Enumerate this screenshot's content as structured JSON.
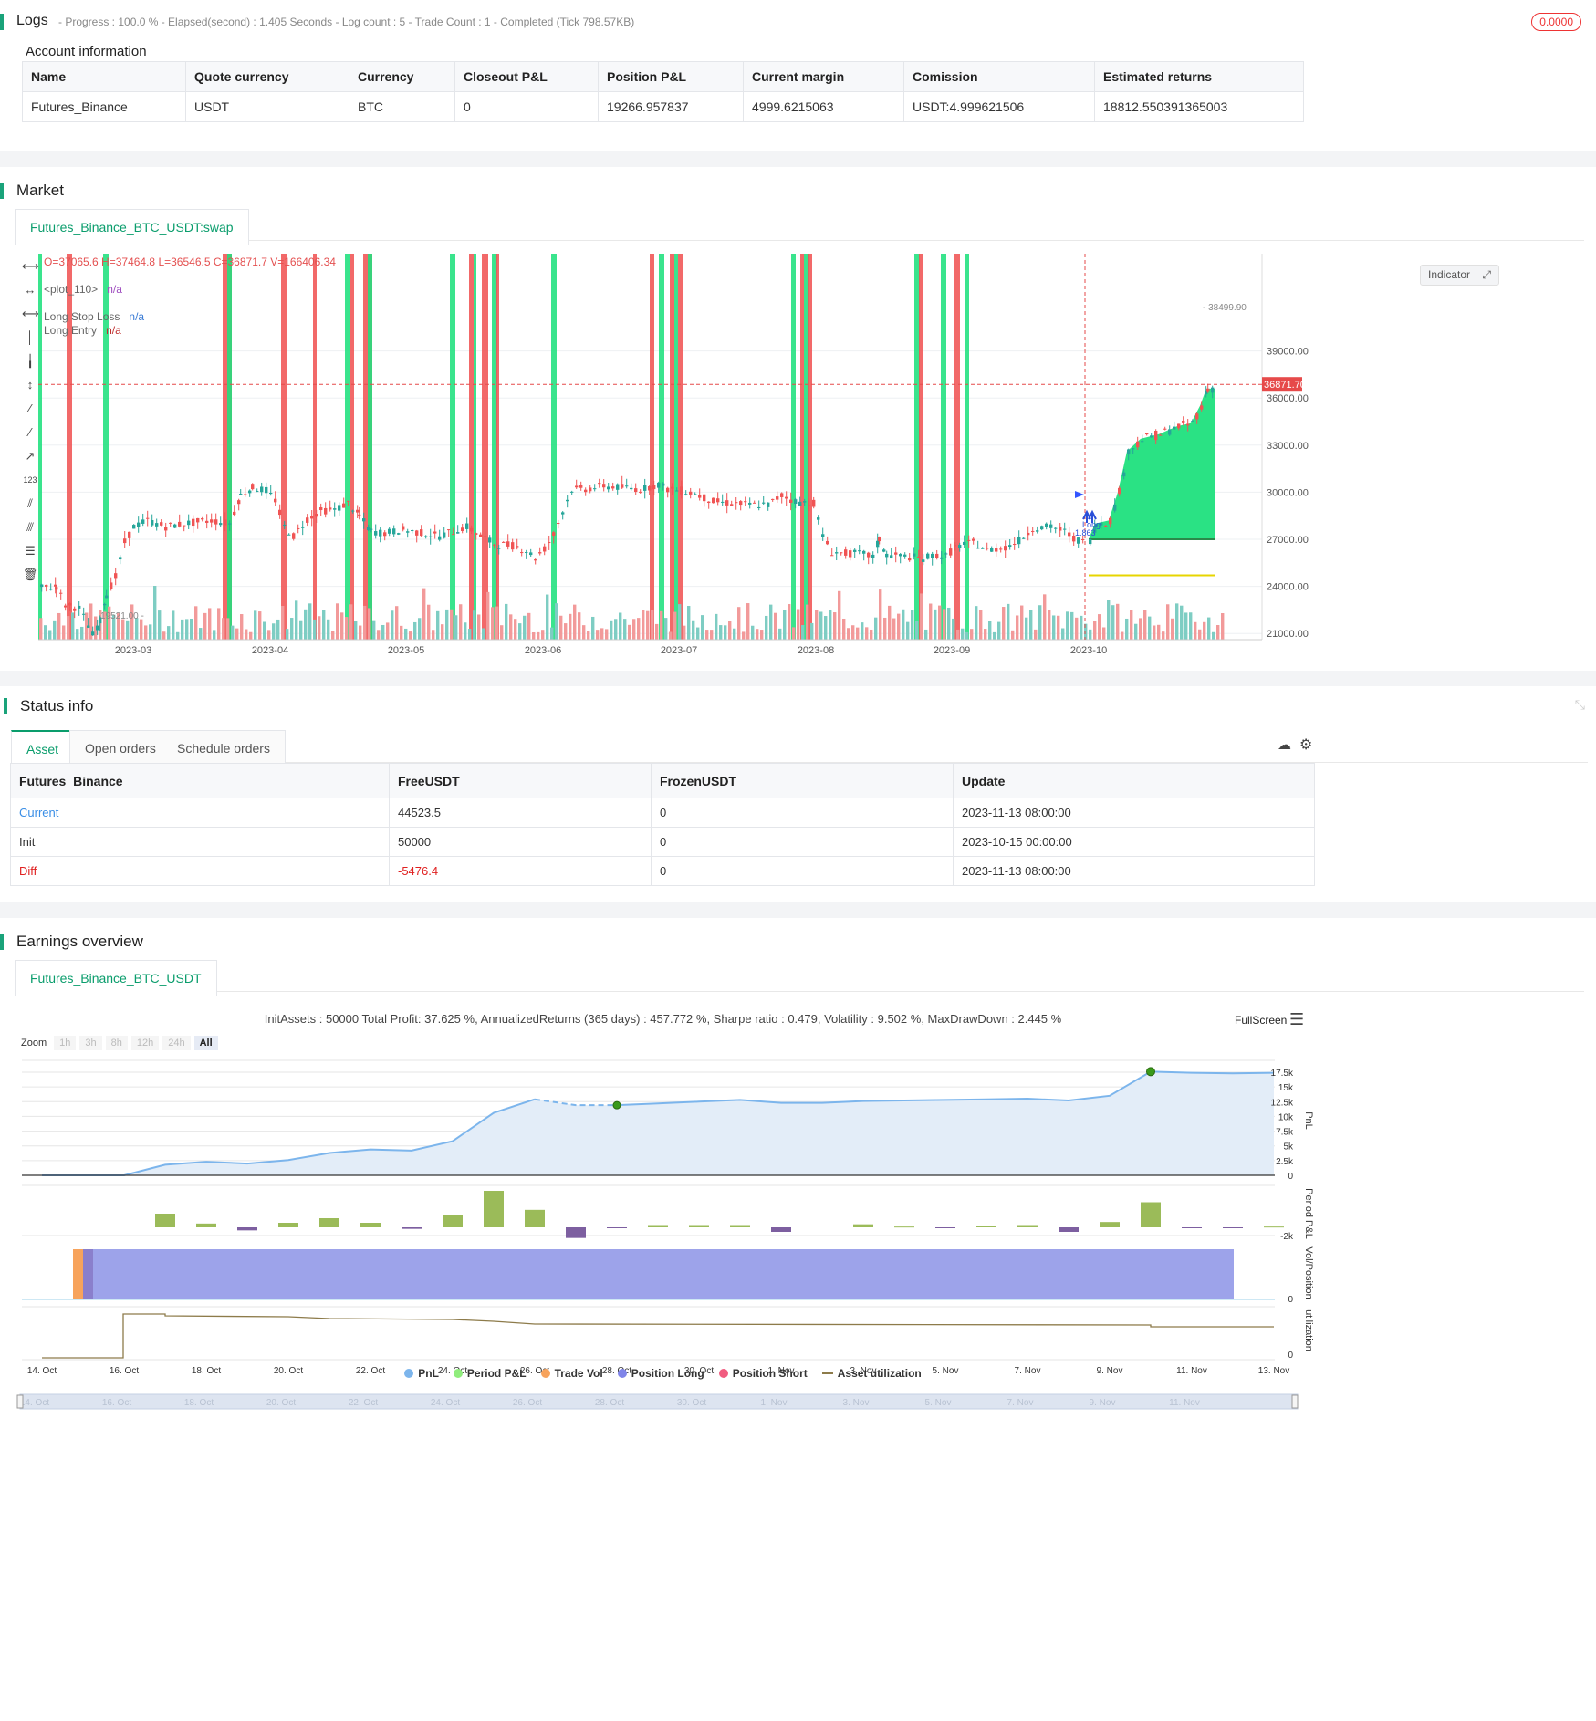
{
  "logs": {
    "title": "Logs",
    "progress_text": "- Progress : 100.0 % - Elapsed(second) : 1.405  Seconds - Log count : 5 - Trade Count : 1 - Completed (Tick 798.57KB)",
    "badge": "0.0000"
  },
  "account": {
    "title": "Account information",
    "headers": [
      "Name",
      "Quote currency",
      "Currency",
      "Closeout P&L",
      "Position P&L",
      "Current margin",
      "Comission",
      "Estimated returns"
    ],
    "row": [
      "Futures_Binance",
      "USDT",
      "BTC",
      "0",
      "19266.957837",
      "4999.6215063",
      "USDT:4.999621506",
      "18812.550391365003"
    ]
  },
  "market": {
    "title": "Market",
    "tab": "Futures_Binance_BTC_USDT:swap",
    "ohlc": "O=37065.6 H=37464.8 L=36546.5 C=36871.7 V=166406.34",
    "legend": [
      {
        "label": "<plot_110>",
        "value": "n/a"
      },
      {
        "label": "Long Stop Loss",
        "value": "n/a"
      },
      {
        "label": "Long Entry",
        "value": "n/a"
      }
    ],
    "indicator_btn": "Indicator",
    "price_label": "36871.70",
    "high_label": "38499.90",
    "low_label": "19521.00",
    "long_label": "Long",
    "long_qty": "1.863",
    "y_ticks": [
      "39000.00",
      "36000.00",
      "33000.00",
      "30000.00",
      "27000.00",
      "24000.00",
      "21000.00"
    ],
    "x_ticks": [
      "2023-03",
      "2023-04",
      "2023-05",
      "2023-06",
      "2023-07",
      "2023-08",
      "2023-09",
      "2023-10"
    ],
    "colors": {
      "green": "#1fe07d",
      "red": "#f05454",
      "teal": "#26a69a"
    }
  },
  "status": {
    "title": "Status info",
    "tabs": [
      "Asset",
      "Open orders",
      "Schedule orders"
    ],
    "headers": [
      "Futures_Binance",
      "FreeUSDT",
      "FrozenUSDT",
      "Update"
    ],
    "rows": [
      [
        "Current",
        "44523.5",
        "0",
        "2023-11-13 08:00:00"
      ],
      [
        "Init",
        "50000",
        "0",
        "2023-10-15 00:00:00"
      ],
      [
        "Diff",
        "-5476.4",
        "0",
        "2023-11-13 08:00:00"
      ]
    ]
  },
  "earnings": {
    "title": "Earnings overview",
    "tab": "Futures_Binance_BTC_USDT",
    "summary": "InitAssets : 50000 Total Profit: 37.625 %, AnnualizedReturns (365 days) : 457.772 %, Sharpe ratio : 0.479, Volatility : 9.502 %, MaxDrawDown : 2.445 %",
    "fullscreen": "FullScreen",
    "zoom_label": "Zoom",
    "zoom_opts": [
      "1h",
      "3h",
      "8h",
      "12h",
      "24h",
      "All"
    ],
    "pnl_ticks": [
      "17.5k",
      "15k",
      "12.5k",
      "10k",
      "7.5k",
      "5k",
      "2.5k",
      "0"
    ],
    "ppl_tick": "-2k",
    "zero": "0",
    "axis_titles": [
      "PnL",
      "Period P&L",
      "Vol/Position",
      "utilization"
    ],
    "x_ticks": [
      "14. Oct",
      "16. Oct",
      "18. Oct",
      "20. Oct",
      "22. Oct",
      "24. Oct",
      "26. Oct",
      "28. Oct",
      "30. Oct",
      "1. Nov",
      "3. Nov",
      "5. Nov",
      "7. Nov",
      "9. Nov",
      "11. Nov",
      "13. Nov"
    ],
    "legend": [
      {
        "name": "PnL",
        "color": "#7cb5ec"
      },
      {
        "name": "Period P&L",
        "color": "#90ed7d"
      },
      {
        "name": "Trade Vol",
        "color": "#f7a35c"
      },
      {
        "name": "Position Long",
        "color": "#8085e9"
      },
      {
        "name": "Position Short",
        "color": "#f15c80"
      },
      {
        "name": "Asset utilization",
        "color": "#8d7b4a"
      }
    ]
  }
}
